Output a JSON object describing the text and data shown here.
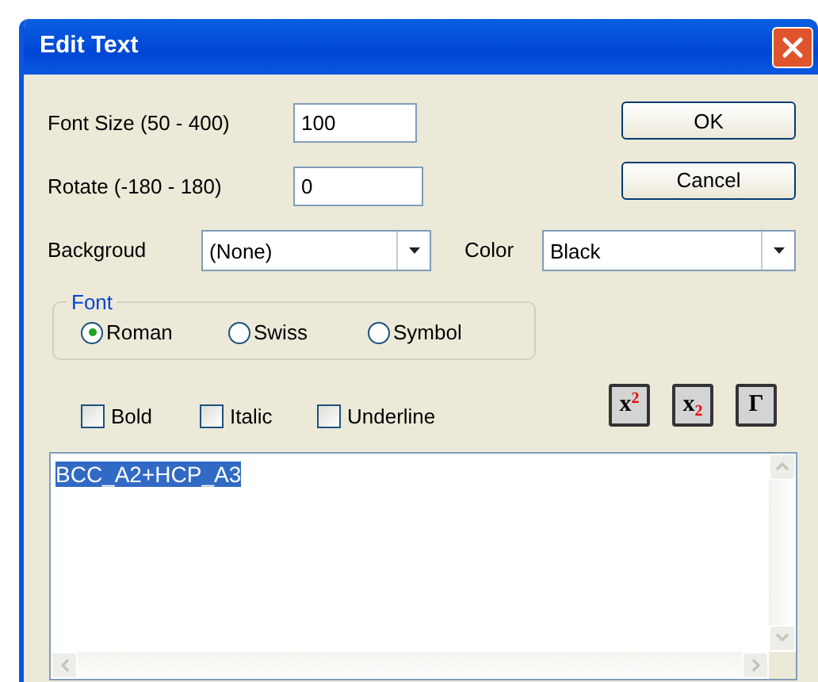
{
  "window": {
    "title": "Edit Text"
  },
  "fields": [
    {
      "label": "Font Size (50 - 400)",
      "value": "100"
    },
    {
      "label": "Rotate (-180 - 180)",
      "value": "0"
    }
  ],
  "buttons": [
    "OK",
    "Cancel"
  ],
  "dropdowns": [
    {
      "label": "Backgroud",
      "value": "(None)"
    },
    {
      "label": "Color",
      "value": "Black"
    }
  ],
  "font_group": {
    "legend": "Font",
    "options": [
      {
        "label": "Roman",
        "selected": true
      },
      {
        "label": "Swiss",
        "selected": false
      },
      {
        "label": "Symbol",
        "selected": false
      }
    ]
  },
  "styles": [
    {
      "label": "Bold",
      "checked": false
    },
    {
      "label": "Italic",
      "checked": false
    },
    {
      "label": "Underline",
      "checked": false
    }
  ],
  "format_buttons": [
    "x$^{2}$",
    "x$_{2}$",
    "Γ"
  ],
  "text_area": {
    "value": "BCC_A2+HCP_A3",
    "text_selected": true
  }
}
